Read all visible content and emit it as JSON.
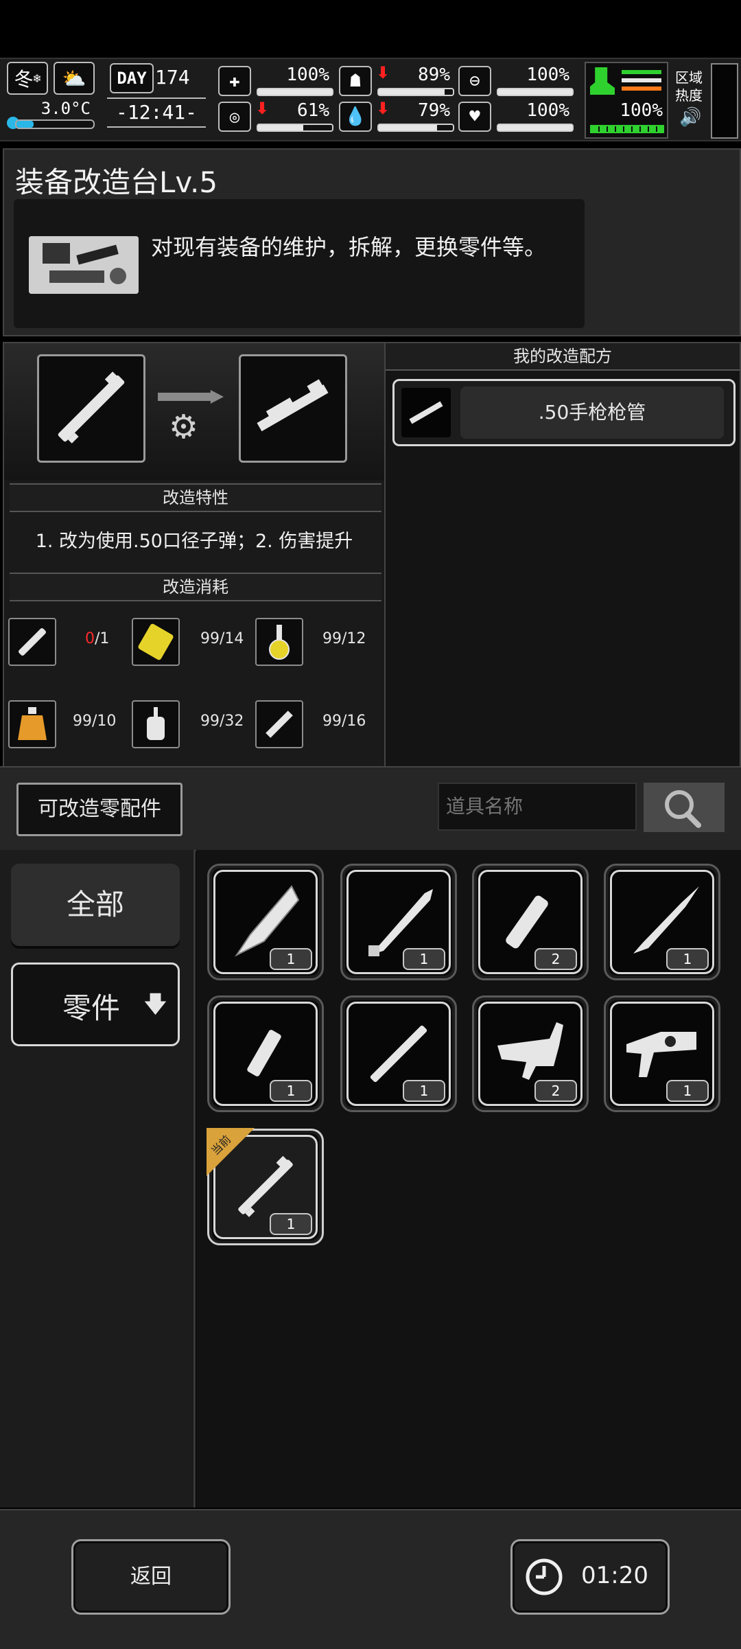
{
  "hud": {
    "season": "冬",
    "temperature": "3.0°C",
    "day_label": "DAY",
    "day_value": "174",
    "clock": "-12:41-",
    "stats": [
      {
        "icon": "medkit-icon",
        "value": "100%",
        "fill": 1.0,
        "down": false
      },
      {
        "icon": "stomach-icon",
        "value": "89%",
        "fill": 0.89,
        "down": true
      },
      {
        "icon": "pill-icon",
        "value": "100%",
        "fill": 1.0,
        "down": false
      },
      {
        "icon": "brain-icon",
        "value": "61%",
        "fill": 0.61,
        "down": true
      },
      {
        "icon": "water-drop-icon",
        "value": "79%",
        "fill": 0.79,
        "down": true
      },
      {
        "icon": "heart-icon",
        "value": "100%",
        "fill": 1.0,
        "down": false
      }
    ],
    "stamina": {
      "value": "100%",
      "fill": 1.0,
      "color": "#2fd12f"
    },
    "zone_heat_label": "区域\n热度"
  },
  "header": {
    "title": "装备改造台Lv.5",
    "description": "对现有装备的维护，拆解，更换零件等。"
  },
  "mod": {
    "traits_title": "改造特性",
    "traits_text": "1. 改为使用.50口径子弹；2. 伤害提升",
    "cost_title": "改造消耗",
    "materials": [
      {
        "icon": "barrel-part-icon",
        "have": "0",
        "need": "/1",
        "insufficient": true
      },
      {
        "icon": "yellow-card-icon",
        "have": "99/14",
        "need": "",
        "insufficient": false
      },
      {
        "icon": "flask-icon",
        "have": "99/12",
        "need": "",
        "insufficient": false
      },
      {
        "icon": "lantern-icon",
        "have": "99/10",
        "need": "",
        "insufficient": false
      },
      {
        "icon": "oil-bottle-icon",
        "have": "99/32",
        "need": "",
        "insufficient": false
      },
      {
        "icon": "syringe-icon",
        "have": "99/16",
        "need": "",
        "insufficient": false
      }
    ]
  },
  "recipes": {
    "title": "我的改造配方",
    "items": [
      {
        "label": ".50手枪枪管"
      }
    ]
  },
  "parts": {
    "title": "可改造零配件",
    "search_placeholder": "道具名称",
    "categories": [
      {
        "label": "全部"
      },
      {
        "label": "零件"
      }
    ],
    "items": [
      {
        "icon": "curved-blade-icon",
        "count": "1"
      },
      {
        "icon": "serrated-blade-icon",
        "count": "1"
      },
      {
        "icon": "cylinder-part-icon",
        "count": "2"
      },
      {
        "icon": "spear-tip-icon",
        "count": "1"
      },
      {
        "icon": "short-barrel-icon",
        "count": "1"
      },
      {
        "icon": "long-barrel-icon",
        "count": "1"
      },
      {
        "icon": "trigger-assembly-icon",
        "count": "2"
      },
      {
        "icon": "slide-assembly-icon",
        "count": "1"
      },
      {
        "icon": "pistol-barrel-icon",
        "count": "1",
        "badge": "当前"
      }
    ]
  },
  "footer": {
    "back_label": "返回",
    "timer": "01:20"
  }
}
